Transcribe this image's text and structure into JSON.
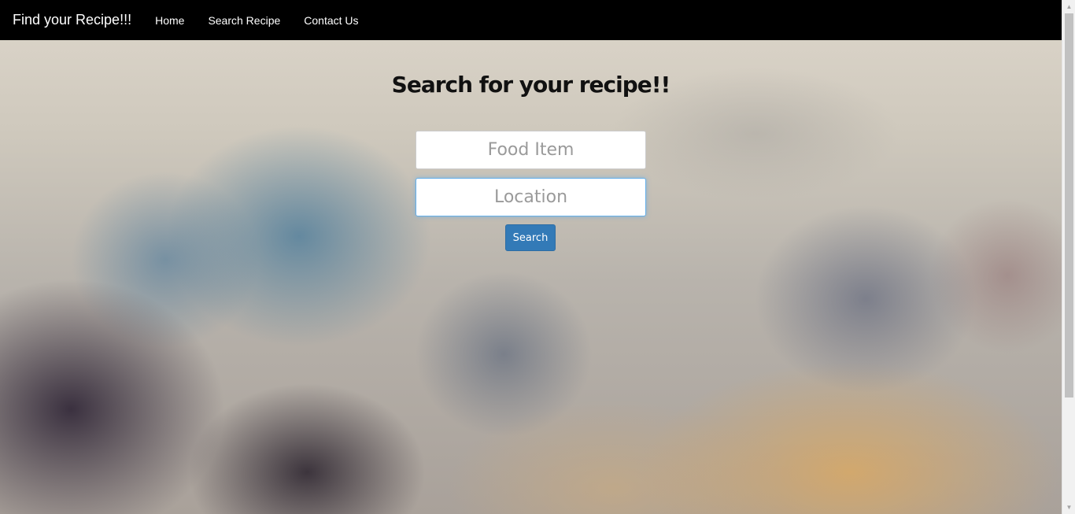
{
  "navbar": {
    "brand": "Find your Recipe!!!",
    "links": [
      {
        "label": "Home"
      },
      {
        "label": "Search Recipe"
      },
      {
        "label": "Contact Us"
      }
    ]
  },
  "main": {
    "title": "Search for your recipe!!",
    "food_field": {
      "placeholder": "Food Item",
      "value": ""
    },
    "location_field": {
      "placeholder": "Location",
      "value": ""
    },
    "search_button": "Search"
  },
  "colors": {
    "navbar_bg": "#000000",
    "button_bg": "#337ab7",
    "focus_border": "#66afe9"
  },
  "icons": {
    "scroll_up": "▲",
    "scroll_down": "▼"
  }
}
